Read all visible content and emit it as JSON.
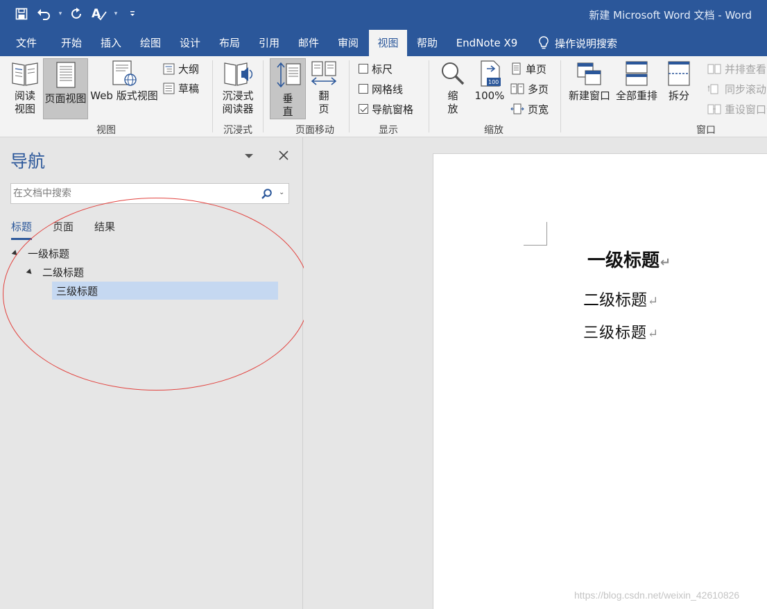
{
  "app": {
    "window_title": "新建 Microsoft Word 文档 - Word"
  },
  "quick_access": {
    "icons": [
      "save-icon",
      "undo-icon",
      "redo-icon",
      "spelling-icon",
      "customize-icon"
    ]
  },
  "tabs": [
    {
      "label": "文件"
    },
    {
      "label": "开始"
    },
    {
      "label": "插入"
    },
    {
      "label": "绘图"
    },
    {
      "label": "设计"
    },
    {
      "label": "布局"
    },
    {
      "label": "引用"
    },
    {
      "label": "邮件"
    },
    {
      "label": "审阅"
    },
    {
      "label": "视图",
      "active": true
    },
    {
      "label": "帮助"
    },
    {
      "label": "EndNote X9"
    }
  ],
  "tell_me": "操作说明搜索",
  "ribbon": {
    "views": {
      "label": "视图",
      "read_mode_l1": "阅读",
      "read_mode_l2": "视图",
      "print_layout": "页面视图",
      "web_layout": "Web 版式视图",
      "outline": "大纲",
      "draft": "草稿"
    },
    "immersive": {
      "label": "沉浸式",
      "reader_l1": "沉浸式",
      "reader_l2": "阅读器"
    },
    "page_movement": {
      "label": "页面移动",
      "vertical_l1": "垂",
      "vertical_l2": "直",
      "side_l1": "翻",
      "side_l2": "页"
    },
    "show": {
      "label": "显示",
      "ruler": {
        "text": "标尺",
        "checked": false
      },
      "gridlines": {
        "text": "网格线",
        "checked": false
      },
      "nav_pane": {
        "text": "导航窗格",
        "checked": true
      }
    },
    "zoom": {
      "label": "缩放",
      "zoom_l1": "缩",
      "zoom_l2": "放",
      "hundred": "100%",
      "one_page": "单页",
      "multiple_pages": "多页",
      "page_width": "页宽"
    },
    "window": {
      "label": "窗口",
      "new_window": "新建窗口",
      "arrange_all": "全部重排",
      "split": "拆分",
      "side_by_side": "并排查看",
      "sync_scroll": "同步滚动",
      "reset_position": "重设窗口位"
    }
  },
  "navigation": {
    "title": "导航",
    "search_placeholder": "在文档中搜索",
    "tabs": [
      {
        "label": "标题",
        "active": true
      },
      {
        "label": "页面"
      },
      {
        "label": "结果"
      }
    ],
    "tree": [
      {
        "label": "一级标题",
        "level": 1,
        "expanded": true
      },
      {
        "label": "二级标题",
        "level": 2,
        "expanded": true
      },
      {
        "label": "三级标题",
        "level": 3,
        "selected": true
      }
    ]
  },
  "document": {
    "headings": [
      {
        "text": "一级标题",
        "mark": "↵"
      },
      {
        "text": "二级标题",
        "mark": "↵"
      },
      {
        "text": "三级标题",
        "mark": "↵"
      }
    ]
  },
  "watermark": "https://blog.csdn.net/weixin_42610826",
  "colors": {
    "accent": "#2b579a",
    "ribbon_bg": "#f3f3f3",
    "pane_bg": "#e6e6e6",
    "selection": "#c5d8f1",
    "annotation": "#e2433f"
  }
}
